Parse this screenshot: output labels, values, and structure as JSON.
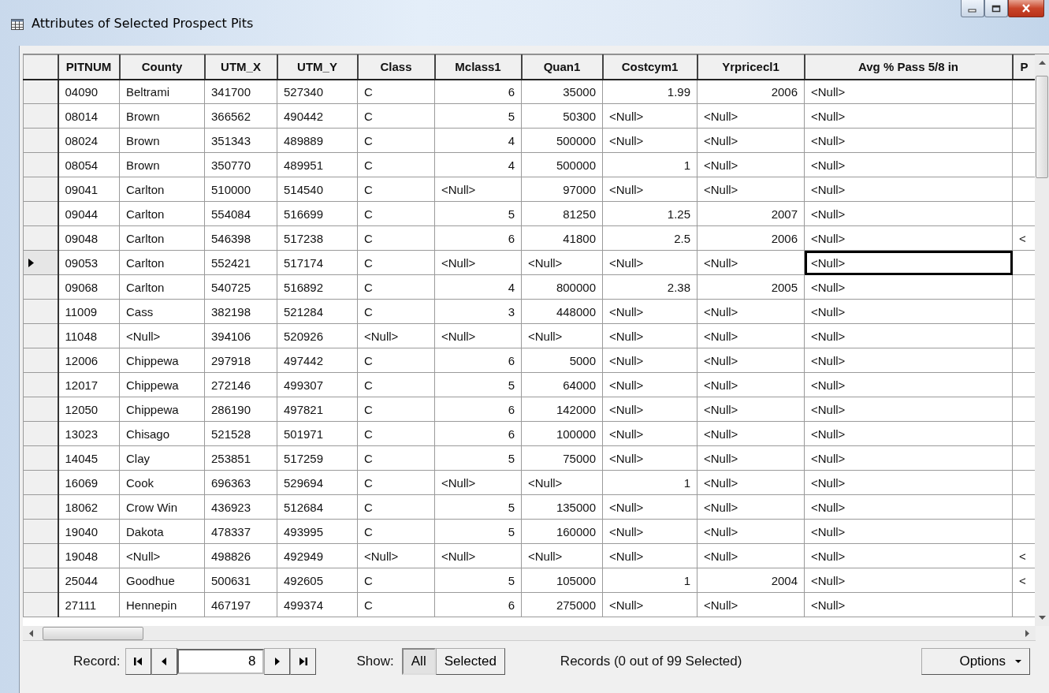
{
  "window": {
    "title": "Attributes of Selected Prospect Pits"
  },
  "table": {
    "columns": [
      {
        "label": "PITNUM",
        "kind": "text"
      },
      {
        "label": "County",
        "kind": "text"
      },
      {
        "label": "UTM_X",
        "kind": "text"
      },
      {
        "label": "UTM_Y",
        "kind": "text"
      },
      {
        "label": "Class",
        "kind": "text"
      },
      {
        "label": "Mclass1",
        "kind": "number"
      },
      {
        "label": "Quan1",
        "kind": "number"
      },
      {
        "label": "Costcym1",
        "kind": "number"
      },
      {
        "label": "Yrpricecl1",
        "kind": "number"
      },
      {
        "label": "Avg % Pass 5/8 in",
        "kind": "text"
      },
      {
        "label": "P",
        "kind": "text"
      }
    ],
    "rows": [
      {
        "selected": false,
        "cells": [
          "04090",
          "Beltrami",
          "341700",
          "527340",
          "C",
          "6",
          "35000",
          "1.99",
          "2006",
          "<Null>"
        ]
      },
      {
        "selected": false,
        "cells": [
          "08014",
          "Brown",
          "366562",
          "490442",
          "C",
          "5",
          "50300",
          "<Null>",
          "<Null>",
          "<Null>"
        ]
      },
      {
        "selected": false,
        "cells": [
          "08024",
          "Brown",
          "351343",
          "489889",
          "C",
          "4",
          "500000",
          "<Null>",
          "<Null>",
          "<Null>"
        ]
      },
      {
        "selected": false,
        "cells": [
          "08054",
          "Brown",
          "350770",
          "489951",
          "C",
          "4",
          "500000",
          "1",
          "<Null>",
          "<Null>"
        ]
      },
      {
        "selected": false,
        "cells": [
          "09041",
          "Carlton",
          "510000",
          "514540",
          "C",
          "<Null>",
          "97000",
          "<Null>",
          "<Null>",
          "<Null>"
        ]
      },
      {
        "selected": false,
        "cells": [
          "09044",
          "Carlton",
          "554084",
          "516699",
          "C",
          "5",
          "81250",
          "1.25",
          "2007",
          "<Null>"
        ]
      },
      {
        "selected": false,
        "cells": [
          "09048",
          "Carlton",
          "546398",
          "517238",
          "C",
          "6",
          "41800",
          "2.5",
          "2006",
          "<Null>",
          "<"
        ]
      },
      {
        "selected": true,
        "cells": [
          "09053",
          "Carlton",
          "552421",
          "517174",
          "C",
          "<Null>",
          "<Null>",
          "<Null>",
          "<Null>",
          {
            "text": "<Null>",
            "focused": true
          }
        ]
      },
      {
        "selected": false,
        "cells": [
          "09068",
          "Carlton",
          "540725",
          "516892",
          "C",
          "4",
          "800000",
          "2.38",
          "2005",
          "<Null>"
        ]
      },
      {
        "selected": false,
        "cells": [
          "11009",
          "Cass",
          "382198",
          "521284",
          "C",
          "3",
          "448000",
          "<Null>",
          "<Null>",
          "<Null>"
        ]
      },
      {
        "selected": false,
        "cells": [
          "11048",
          "<Null>",
          "394106",
          "520926",
          "<Null>",
          "<Null>",
          "<Null>",
          "<Null>",
          "<Null>",
          "<Null>"
        ]
      },
      {
        "selected": false,
        "cells": [
          "12006",
          "Chippewa",
          "297918",
          "497442",
          "C",
          "6",
          "5000",
          "<Null>",
          "<Null>",
          "<Null>"
        ]
      },
      {
        "selected": false,
        "cells": [
          "12017",
          "Chippewa",
          "272146",
          "499307",
          "C",
          "5",
          "64000",
          "<Null>",
          "<Null>",
          "<Null>"
        ]
      },
      {
        "selected": false,
        "cells": [
          "12050",
          "Chippewa",
          "286190",
          "497821",
          "C",
          "6",
          "142000",
          "<Null>",
          "<Null>",
          "<Null>"
        ]
      },
      {
        "selected": false,
        "cells": [
          "13023",
          "Chisago",
          "521528",
          "501971",
          "C",
          "6",
          "100000",
          "<Null>",
          "<Null>",
          "<Null>"
        ]
      },
      {
        "selected": false,
        "cells": [
          "14045",
          "Clay",
          "253851",
          "517259",
          "C",
          "5",
          "75000",
          "<Null>",
          "<Null>",
          "<Null>"
        ]
      },
      {
        "selected": false,
        "cells": [
          "16069",
          "Cook",
          "696363",
          "529694",
          "C",
          "<Null>",
          "<Null>",
          "1",
          "<Null>",
          "<Null>"
        ]
      },
      {
        "selected": false,
        "cells": [
          "18062",
          "Crow Win",
          "436923",
          "512684",
          "C",
          "5",
          "135000",
          "<Null>",
          "<Null>",
          "<Null>"
        ]
      },
      {
        "selected": false,
        "cells": [
          "19040",
          "Dakota",
          "478337",
          "493995",
          "C",
          "5",
          "160000",
          "<Null>",
          "<Null>",
          "<Null>"
        ]
      },
      {
        "selected": false,
        "cells": [
          "19048",
          "<Null>",
          "498826",
          "492949",
          "<Null>",
          "<Null>",
          "<Null>",
          "<Null>",
          "<Null>",
          "<Null>",
          "<"
        ]
      },
      {
        "selected": false,
        "cells": [
          "25044",
          "Goodhue",
          "500631",
          "492605",
          "C",
          "5",
          "105000",
          "1",
          "2004",
          "<Null>",
          "<"
        ]
      },
      {
        "selected": false,
        "cells": [
          "27111",
          "Hennepin",
          "467197",
          "499374",
          "C",
          "6",
          "275000",
          "<Null>",
          "<Null>",
          "<Null>"
        ]
      }
    ]
  },
  "footer": {
    "record_label": "Record:",
    "record_value": "8",
    "show_label": "Show:",
    "show_options": [
      {
        "label": "All",
        "selected": true
      },
      {
        "label": "Selected",
        "selected": false
      }
    ],
    "status": "Records (0 out of 99 Selected)",
    "options_button": "Options"
  }
}
